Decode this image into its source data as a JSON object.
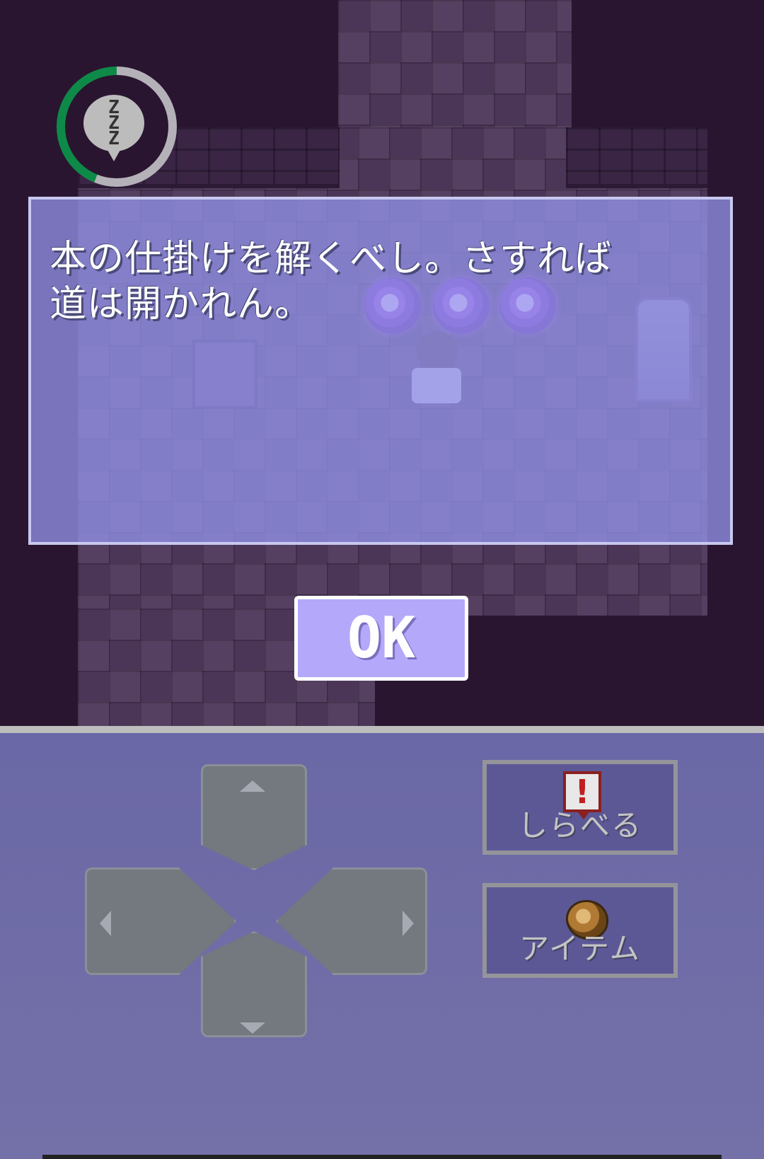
{
  "dialog": {
    "message": "本の仕掛けを解くべし。さすれば\n道は開かれん。",
    "ok_label": "OK"
  },
  "status": {
    "sleep_icon_text": "Z\nZ\nZ",
    "sleep_gauge_fraction": 0.44,
    "gauge_color": "#0e8a48"
  },
  "controls": {
    "investigate_label": "しらべる",
    "investigate_icon": "exclamation-icon",
    "item_label": "アイテム",
    "item_icon": "pouch-icon",
    "dpad": [
      "up",
      "down",
      "left",
      "right"
    ]
  }
}
